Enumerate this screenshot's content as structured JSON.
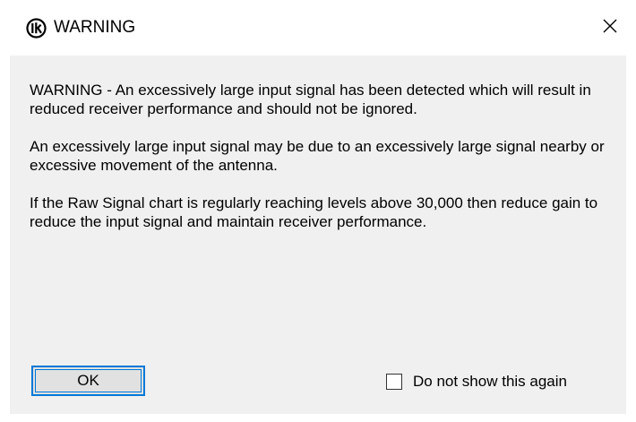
{
  "window": {
    "title": "WARNING",
    "icon": "ik-logo-icon"
  },
  "message": {
    "paragraphs": [
      "WARNING - An excessively large input signal has been detected which will result in reduced receiver performance and should not be ignored.",
      "An excessively large input signal may be due to an excessively large signal nearby or excessive movement of the antenna.",
      "If the Raw Signal chart is regularly reaching levels above 30,000 then reduce gain to reduce the input signal and maintain receiver performance."
    ]
  },
  "buttons": {
    "ok_label": "OK"
  },
  "options": {
    "dont_show_label": "Do not show this again",
    "dont_show_checked": false
  },
  "colors": {
    "dialog_background": "#f0f0f0",
    "focus_accent": "#0078d7",
    "button_face": "#e1e1e1"
  }
}
